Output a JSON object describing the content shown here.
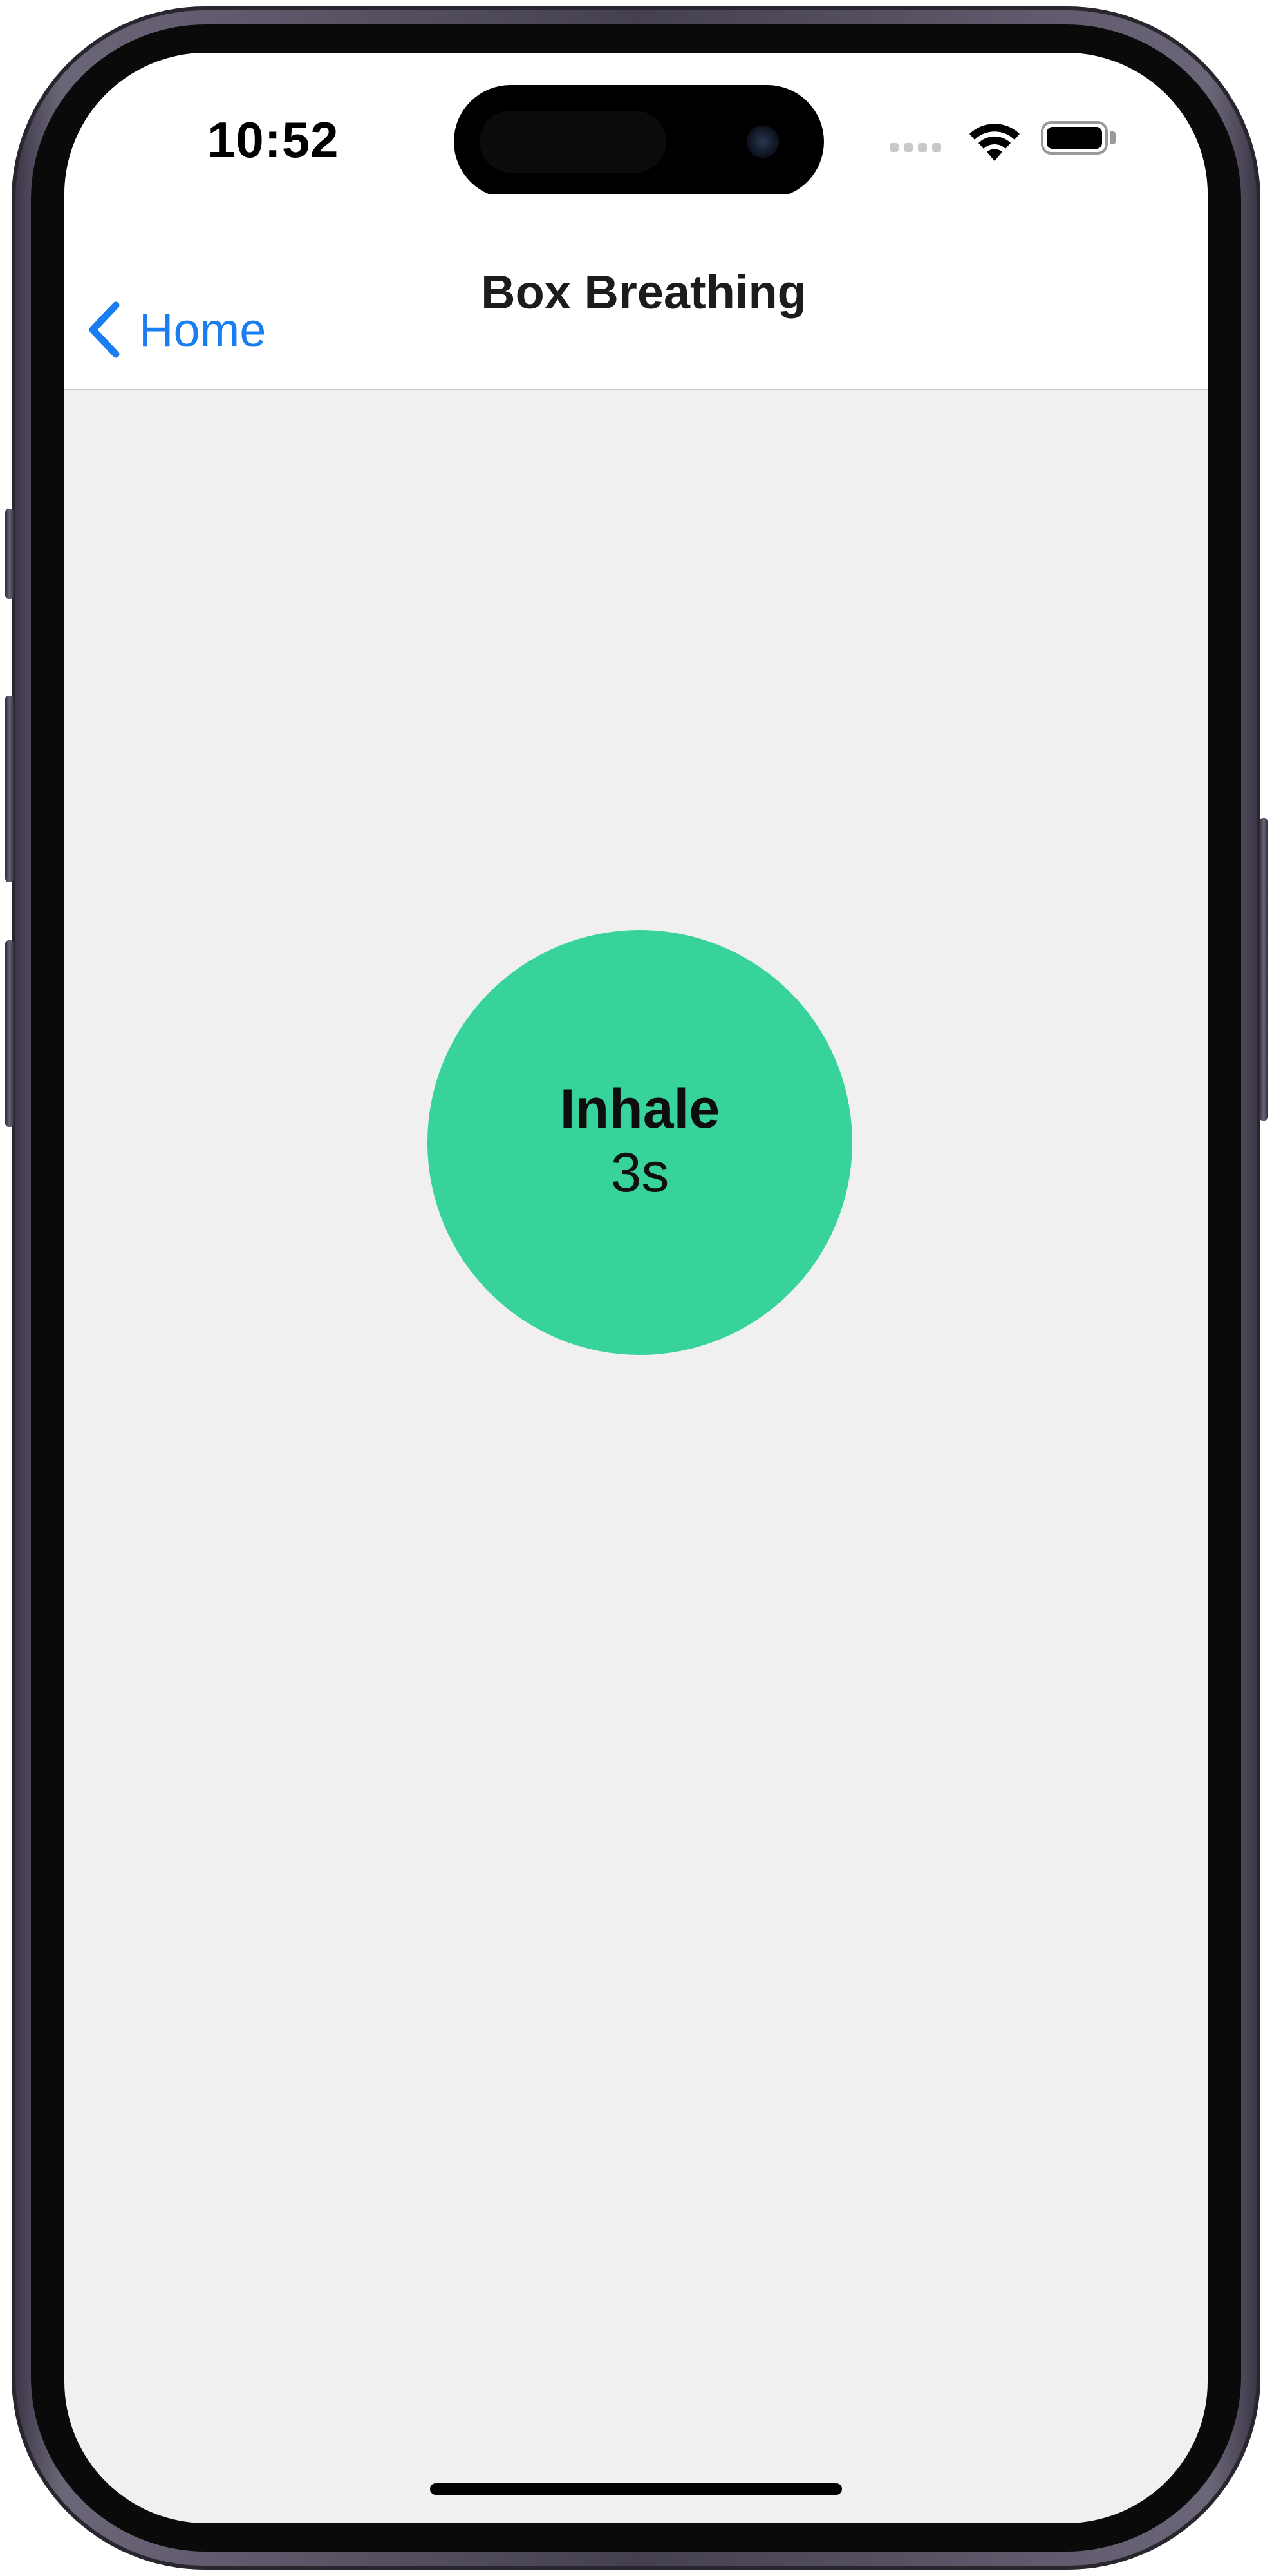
{
  "status_bar": {
    "time": "10:52",
    "wifi_icon": "wifi-icon",
    "battery_icon": "battery-icon",
    "signal_icon": "signal-icon"
  },
  "nav": {
    "back_label": "Home",
    "back_icon": "chevron-left-icon",
    "title": "Box Breathing"
  },
  "breathing": {
    "phase": "Inhale",
    "count": "3s",
    "circle_color": "#37d39a"
  },
  "colors": {
    "accent": "#1a7ef2",
    "background": "#f0f0f0"
  }
}
